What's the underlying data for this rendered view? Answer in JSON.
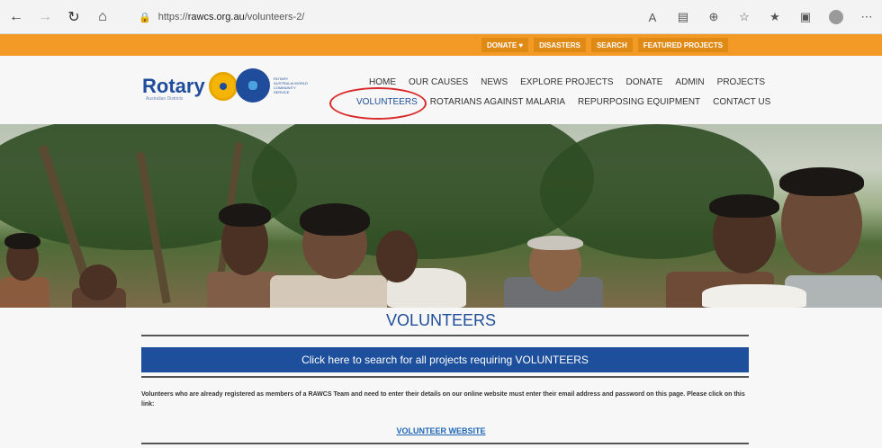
{
  "browser": {
    "url_prefix": "https://",
    "domain": "rawcs.org.au",
    "path": "/volunteers-2/",
    "icons": [
      "back-icon",
      "forward-icon",
      "reload-icon",
      "home-icon",
      "lock-icon",
      "read-aloud-icon",
      "reader-view-icon",
      "zoom-icon",
      "favorite-icon",
      "favorites-icon",
      "collections-icon",
      "profile-icon",
      "more-icon"
    ]
  },
  "top_strip": {
    "links": [
      "DONATE ♥",
      "DISASTERS",
      "SEARCH",
      "FEATURED PROJECTS"
    ]
  },
  "header": {
    "logo_text": "Rotary",
    "logo_sub": "Australian Districts",
    "rawcs_text": "ROTARY AUSTRALIA WORLD COMMUNITY SERVICE",
    "main_nav": [
      "HOME",
      "OUR CAUSES",
      "NEWS",
      "EXPLORE PROJECTS",
      "DONATE",
      "ADMIN",
      "PROJECTS"
    ],
    "sub_nav": [
      "VOLUNTEERS",
      "ROTARIANS AGAINST MALARIA",
      "REPURPOSING EQUIPMENT",
      "CONTACT US"
    ]
  },
  "content": {
    "title": "VOLUNTEERS",
    "search_bar": "Click here to search for all projects requiring VOLUNTEERS",
    "body": "Volunteers who are already registered as members of a RAWCS Team and need to enter their details on our online website must enter their email address and password on this page. Please click on this link:",
    "link": "VOLUNTEER WEBSITE"
  },
  "colors": {
    "accent_orange": "#f29a25",
    "brand_blue": "#1f4d9b",
    "annotation_red": "#d92b2b"
  }
}
